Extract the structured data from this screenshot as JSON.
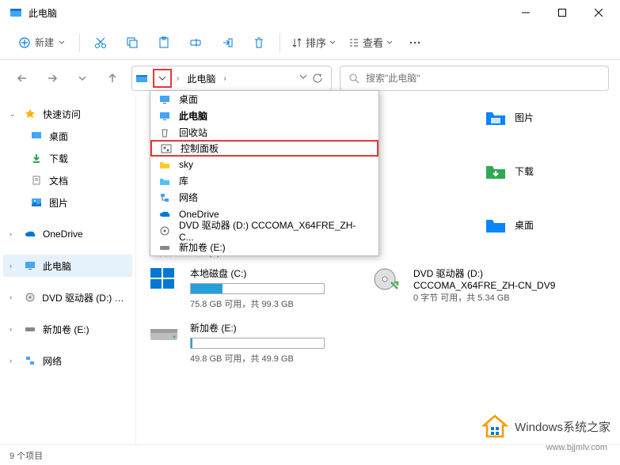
{
  "window": {
    "title": "此电脑"
  },
  "toolbar": {
    "new_label": "新建",
    "sort_label": "排序",
    "view_label": "查看"
  },
  "address": {
    "crumb": "此电脑",
    "chevron": "›"
  },
  "search": {
    "placeholder": "搜索\"此电脑\""
  },
  "dropdown": {
    "items": [
      {
        "label": "桌面",
        "icon": "monitor",
        "bold": false
      },
      {
        "label": "此电脑",
        "icon": "monitor",
        "bold": true
      },
      {
        "label": "回收站",
        "icon": "recycle",
        "bold": false
      },
      {
        "label": "控制面板",
        "icon": "panel",
        "bold": false,
        "highlight": true
      },
      {
        "label": "sky",
        "icon": "folder",
        "bold": false
      },
      {
        "label": "库",
        "icon": "folder",
        "bold": false
      },
      {
        "label": "网络",
        "icon": "network",
        "bold": false
      },
      {
        "label": "OneDrive",
        "icon": "cloud",
        "bold": false
      },
      {
        "label": "DVD 驱动器 (D:) CCCOMA_X64FRE_ZH-C...",
        "icon": "disc",
        "bold": false
      },
      {
        "label": "新加卷 (E:)",
        "icon": "drive",
        "bold": false
      }
    ]
  },
  "sidebar": {
    "quick": "快速访问",
    "desktop": "桌面",
    "downloads": "下载",
    "documents": "文档",
    "pictures": "图片",
    "onedrive": "OneDrive",
    "thispc": "此电脑",
    "dvd": "DVD 驱动器 (D:) CC",
    "newvol": "新加卷 (E:)",
    "network": "网络"
  },
  "content": {
    "right_items": [
      {
        "label": "图片",
        "color": "#0a84ff"
      },
      {
        "label": "下载",
        "color": "#2fa84f"
      },
      {
        "label": "桌面",
        "color": "#0a84ff"
      }
    ],
    "section": "设备和驱动器 (3)",
    "dvd_right": {
      "name": "DVD 驱动器 (D:)",
      "sub": "CCCOMA_X64FRE_ZH-CN_DV9",
      "stat": "0 字节 可用，共 5.34 GB"
    },
    "drives": [
      {
        "name": "本地磁盘 (C:)",
        "stat": "75.8 GB 可用，共 99.3 GB",
        "fill": 24,
        "icon": "win"
      },
      {
        "name": "新加卷 (E:)",
        "stat": "49.8 GB 可用，共 49.9 GB",
        "fill": 1,
        "icon": "hdd"
      }
    ]
  },
  "status": {
    "text": "9 个项目"
  },
  "watermark": {
    "main": "Windows系统之家",
    "sub": "www.bjjmlv.com"
  }
}
